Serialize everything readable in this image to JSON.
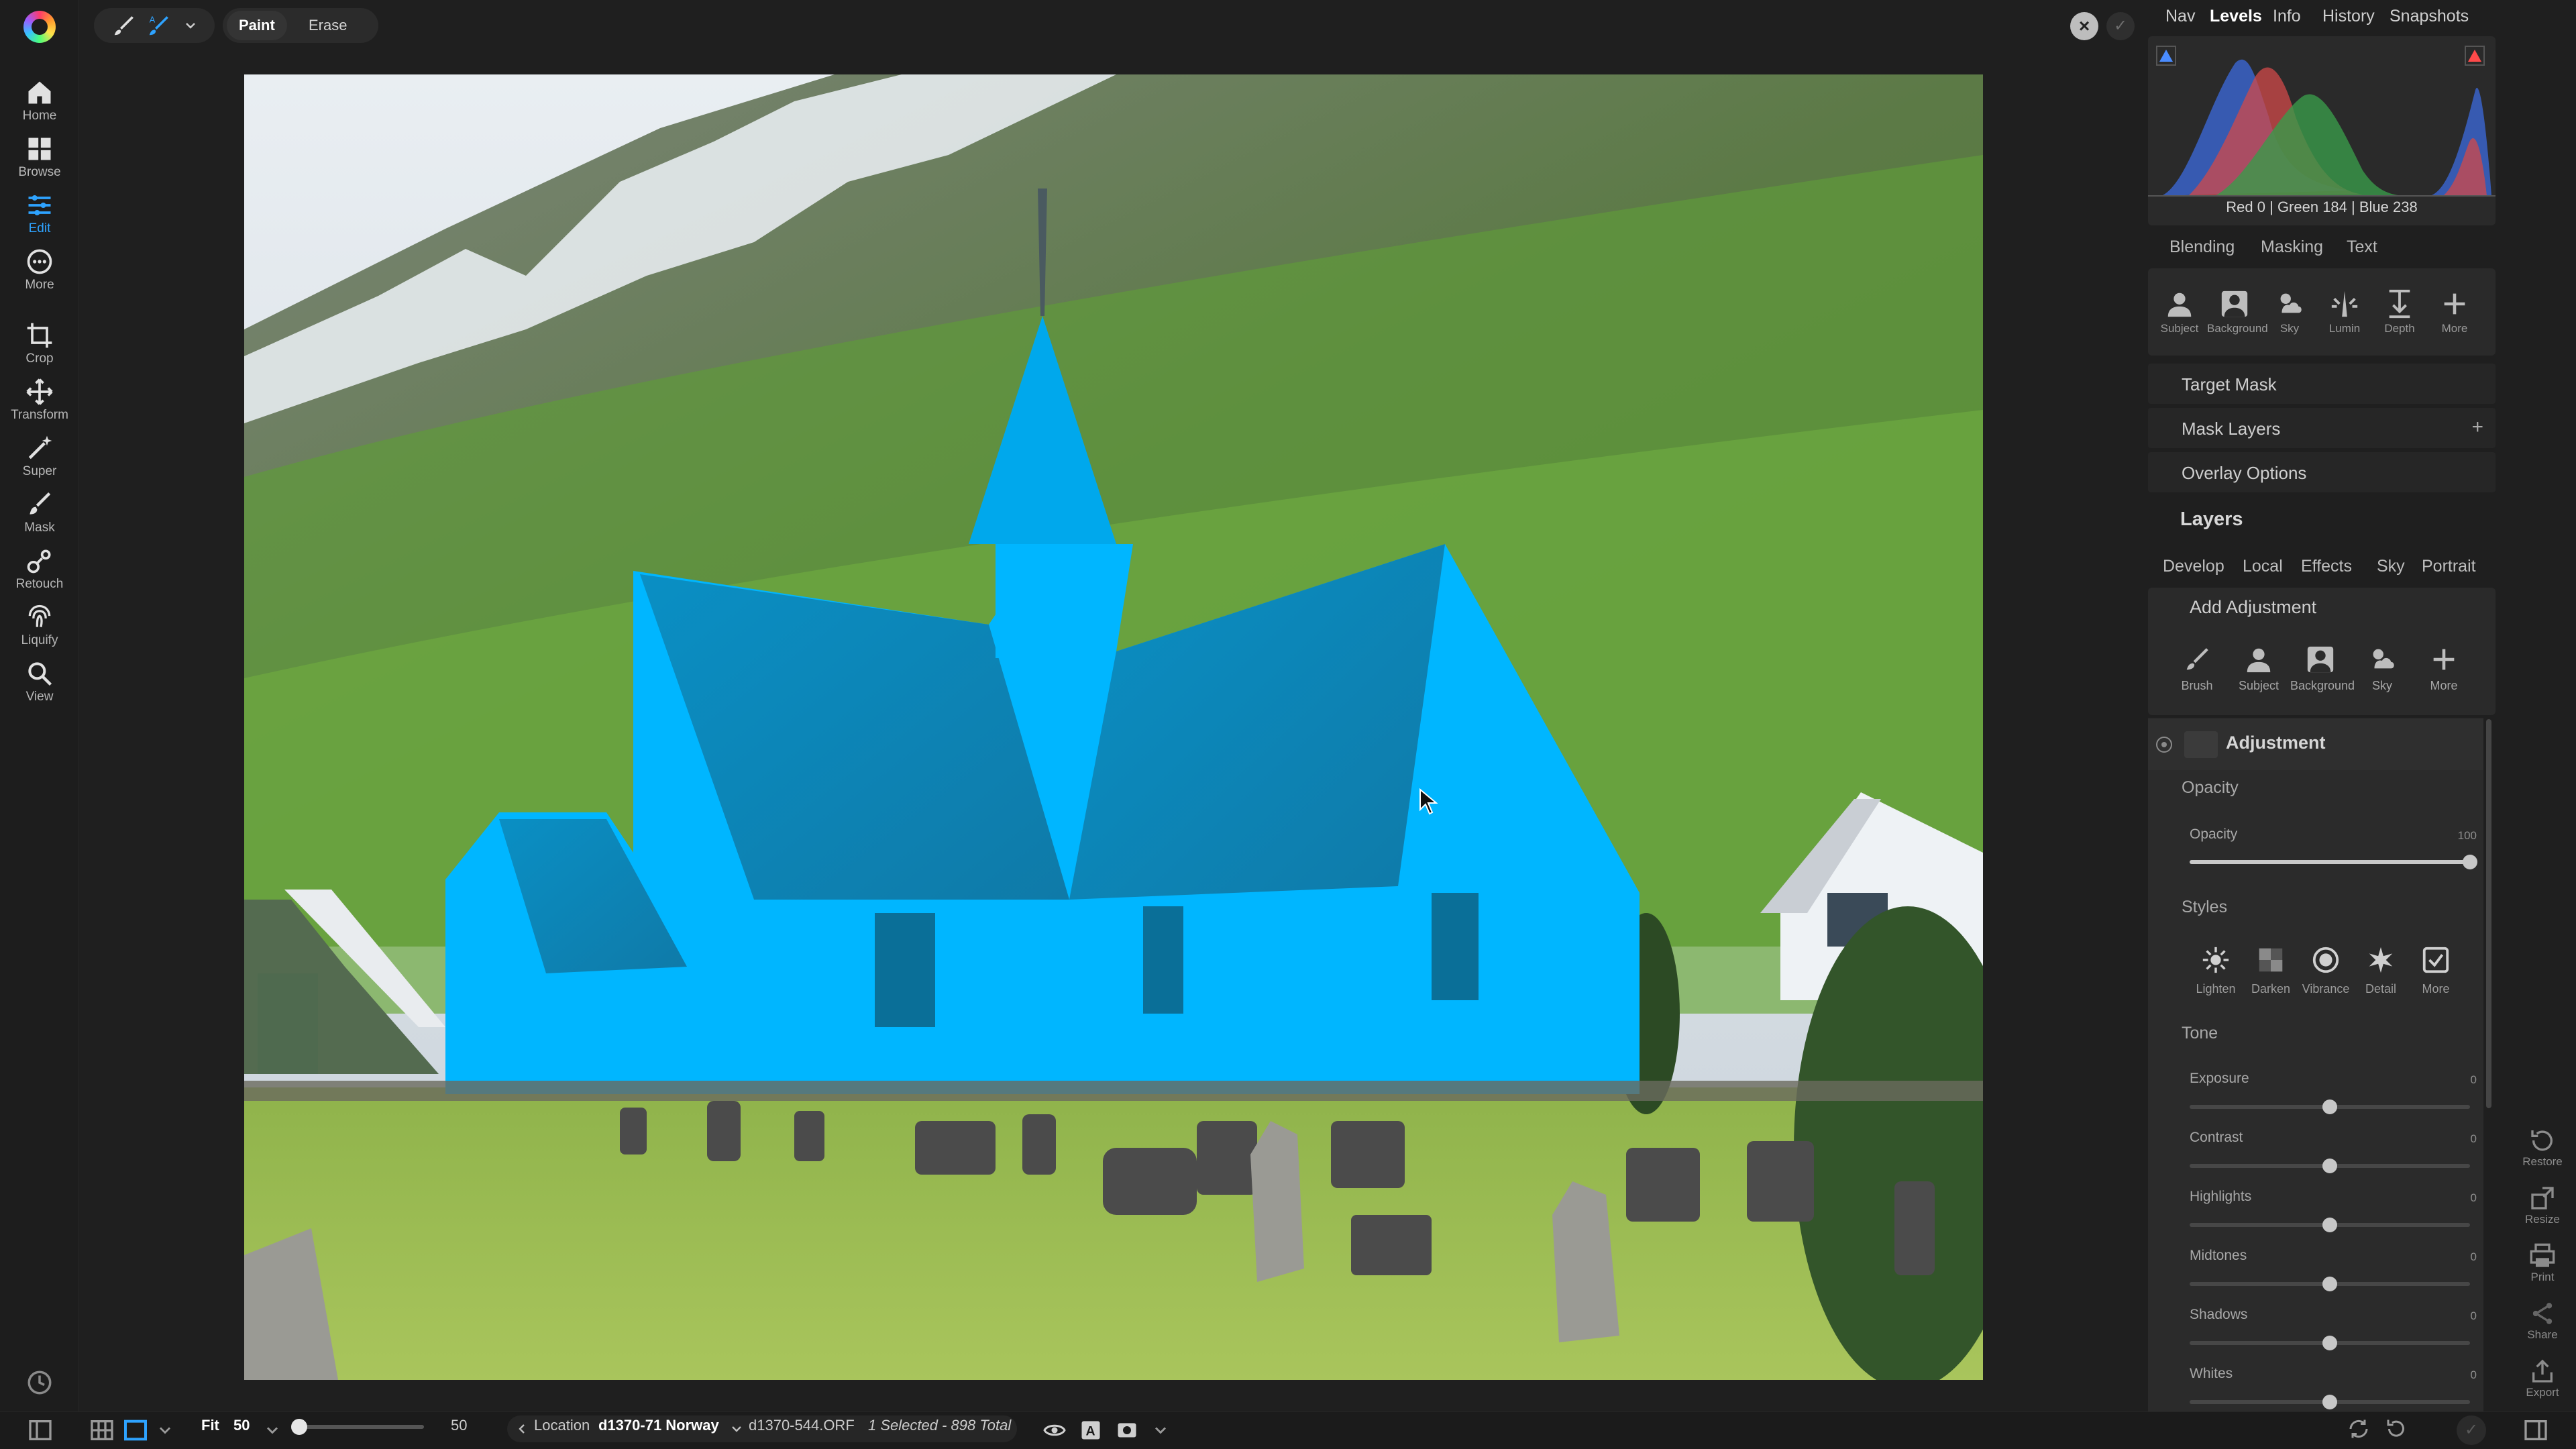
{
  "left_toolbar": {
    "items": [
      {
        "label": "Home",
        "icon": "home-icon"
      },
      {
        "label": "Browse",
        "icon": "grid-icon"
      },
      {
        "label": "Edit",
        "icon": "sliders-icon",
        "active": true
      },
      {
        "label": "More",
        "icon": "more-icon"
      },
      {
        "label": "Crop",
        "icon": "crop-icon"
      },
      {
        "label": "Transform",
        "icon": "transform-icon"
      },
      {
        "label": "Super",
        "icon": "wand-icon"
      },
      {
        "label": "Mask",
        "icon": "mask-brush-icon"
      },
      {
        "label": "Retouch",
        "icon": "retouch-icon"
      },
      {
        "label": "Liquify",
        "icon": "fingerprint-icon"
      },
      {
        "label": "View",
        "icon": "view-icon"
      }
    ]
  },
  "top_toolbar": {
    "paint_label": "Paint",
    "erase_label": "Erase"
  },
  "nav_tabs": [
    "Nav",
    "Levels",
    "Info",
    "History",
    "Snapshots"
  ],
  "histogram": {
    "readout": "Red   0   | Green 184  | Blue 238"
  },
  "mask_tabs": [
    "Blending",
    "Masking",
    "Text"
  ],
  "mask_tools": [
    "Subject",
    "Background",
    "Sky",
    "Lumin",
    "Depth",
    "More"
  ],
  "mask_rows": {
    "target_mask": "Target Mask",
    "mask_layers": "Mask Layers",
    "mask_layers_add": "+",
    "overlay_options": "Overlay Options"
  },
  "layers": {
    "title": "Layers",
    "tabs": [
      "Develop",
      "Local",
      "Effects",
      "Sky",
      "Portrait"
    ],
    "add_adjustment_label": "Add Adjustment",
    "add_tools": [
      "Brush",
      "Subject",
      "Background",
      "Sky",
      "More"
    ]
  },
  "adjustment": {
    "name": "Adjustment",
    "opacity_group": "Opacity",
    "opacity_label": "Opacity",
    "opacity_value": "100",
    "opacity_fraction": 1.0,
    "styles_group": "Styles",
    "styles": [
      "Lighten",
      "Darken",
      "Vibrance",
      "Detail",
      "More"
    ],
    "tone_group": "Tone",
    "tone_sliders": [
      {
        "label": "Exposure",
        "value": "0"
      },
      {
        "label": "Contrast",
        "value": "0"
      },
      {
        "label": "Highlights",
        "value": "0"
      },
      {
        "label": "Midtones",
        "value": "0"
      },
      {
        "label": "Shadows",
        "value": "0"
      },
      {
        "label": "Whites",
        "value": "0"
      }
    ]
  },
  "right_rail": [
    "Restore",
    "Resize",
    "Print",
    "Share",
    "Export"
  ],
  "bottom_bar": {
    "fit_label": "Fit",
    "zoom_value": "50",
    "zoom_slider_value": "50",
    "location_label": "Location",
    "folder": "d1370-71 Norway",
    "filename": "d1370-544.ORF",
    "selection": "1 Selected - 898 Total"
  },
  "colors": {
    "accent": "#2ea3ff",
    "mask_overlay": "#00b6ff",
    "background": "#202020"
  }
}
